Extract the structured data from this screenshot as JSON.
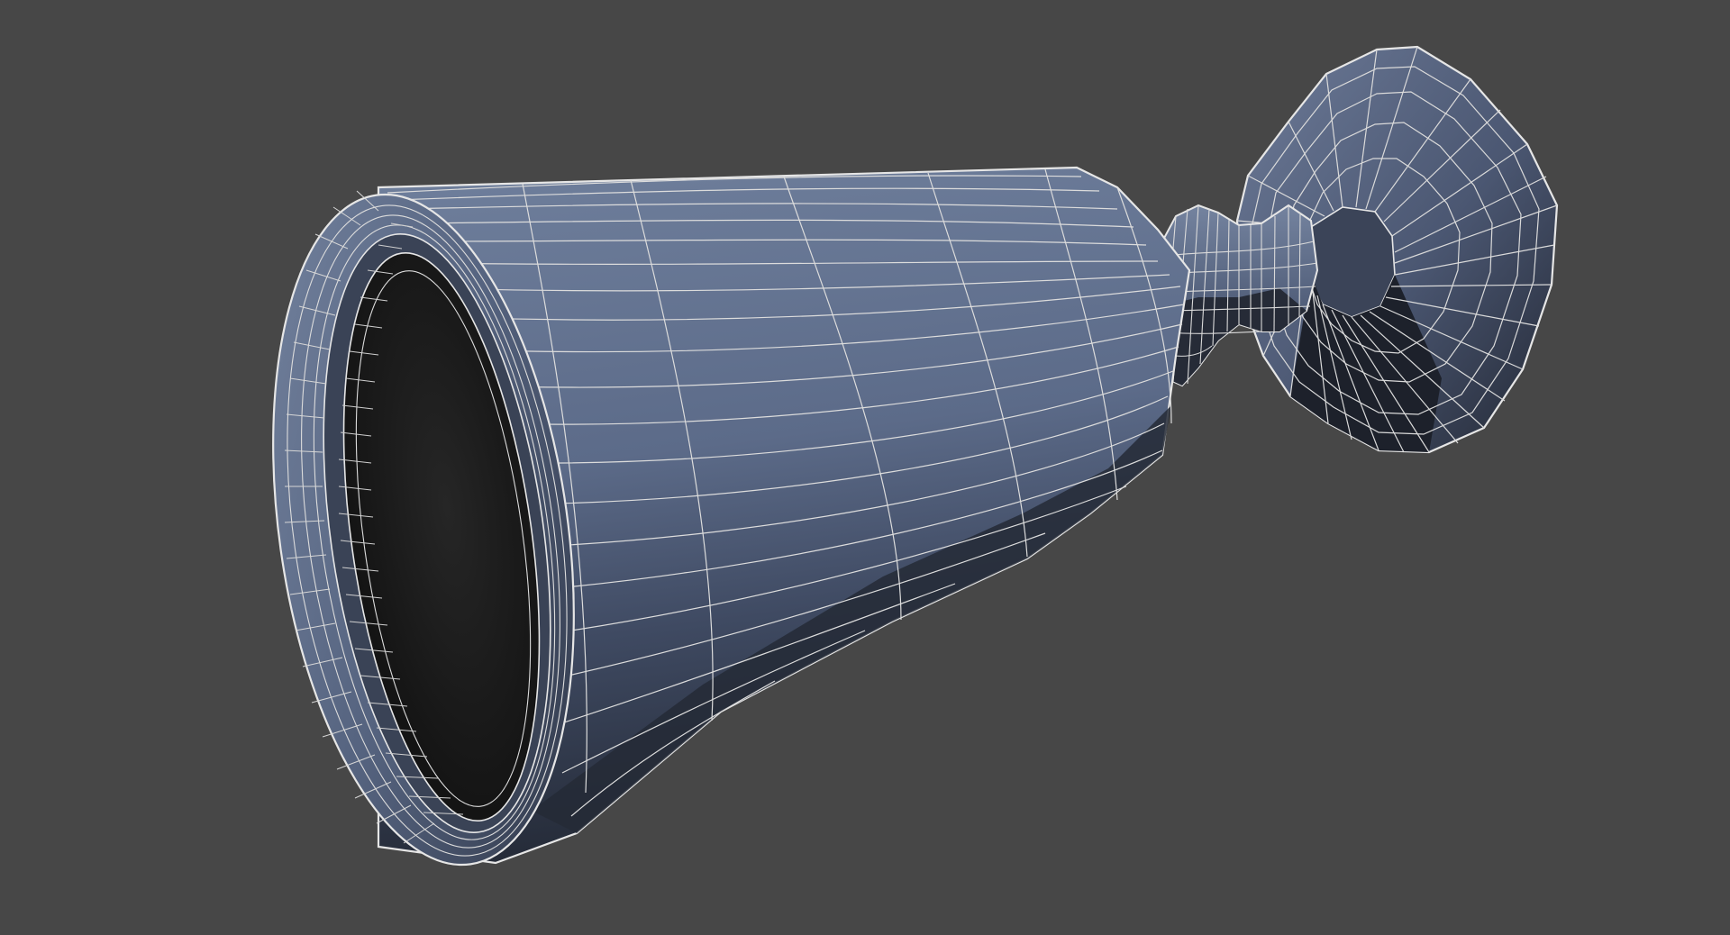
{
  "viewport": {
    "background": "#474747",
    "object": "goblet-wireframe-mesh",
    "shading": "solid-with-wireframe-overlay",
    "colors": {
      "mesh_light": "#6a7996",
      "mesh_mid": "#4f5c78",
      "mesh_dark": "#2b3140",
      "interior": "#161616",
      "wire": "#e2e2e2"
    }
  }
}
